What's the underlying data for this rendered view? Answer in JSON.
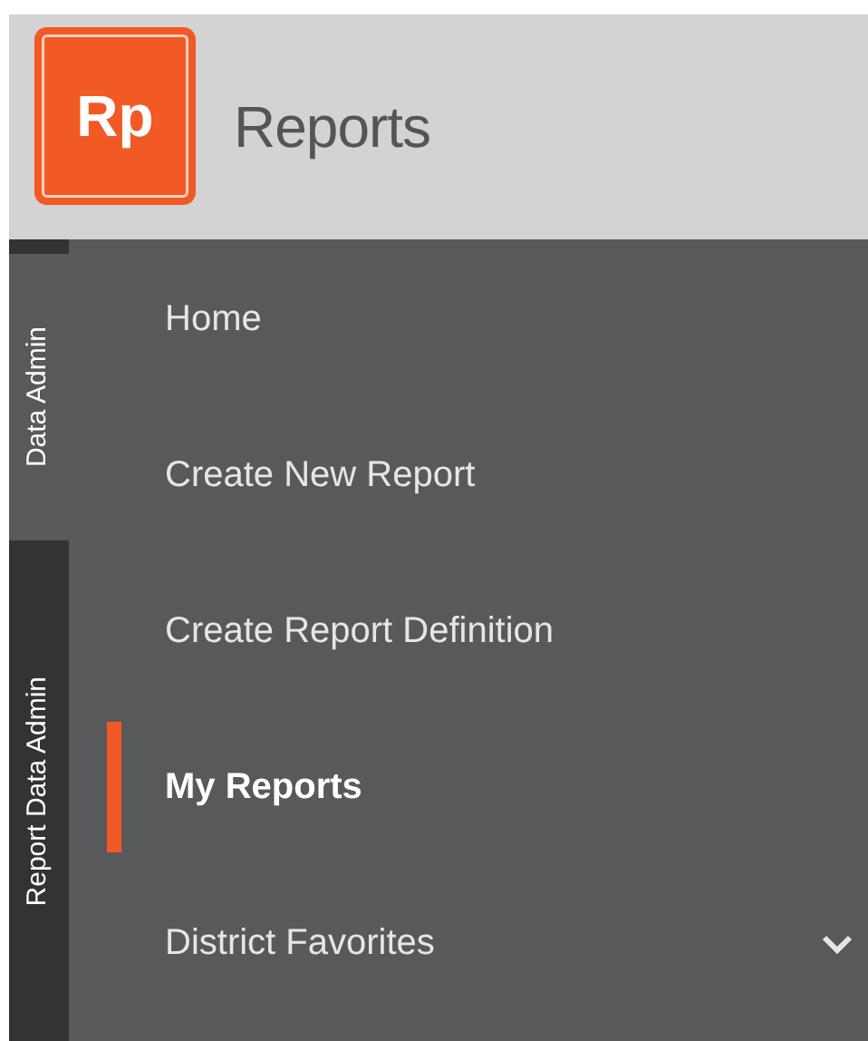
{
  "header": {
    "logo": "Rp",
    "title": "Reports"
  },
  "side_tabs": [
    {
      "label": "Data Admin",
      "selected": true
    },
    {
      "label": "Report Data Admin",
      "selected": false
    }
  ],
  "menu": [
    {
      "label": "Home",
      "selected": false,
      "kind": "link"
    },
    {
      "label": "Create New Report",
      "selected": false,
      "kind": "link"
    },
    {
      "label": "Create Report Definition",
      "selected": false,
      "kind": "link"
    },
    {
      "label": "My Reports",
      "selected": true,
      "kind": "link"
    },
    {
      "label": "District Favorites",
      "selected": false,
      "kind": "group",
      "expanded": false
    }
  ]
}
